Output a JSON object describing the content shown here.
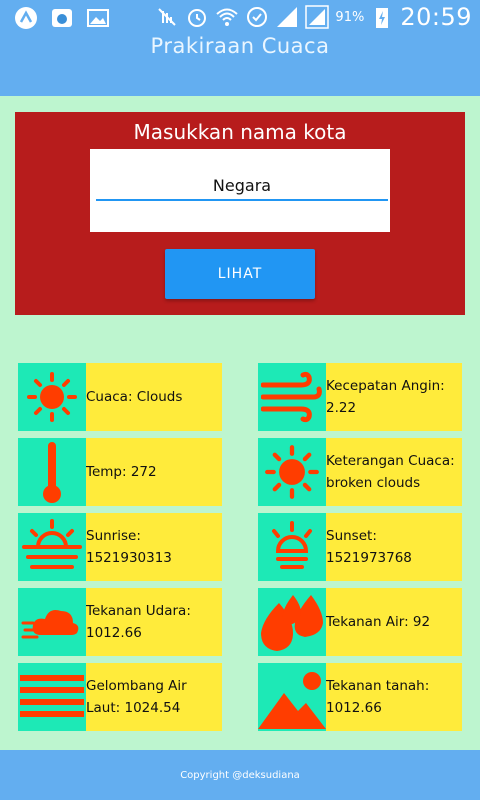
{
  "status_bar": {
    "battery": "91%",
    "time": "20:59"
  },
  "app": {
    "title": "Prakiraan Cuaca"
  },
  "form": {
    "label": "Masukkan nama kota",
    "city_value": "Negara",
    "button_label": "LIHAT"
  },
  "tiles": {
    "weather": "Cuaca: Clouds",
    "wind": "Kecepatan Angin: 2.22",
    "temp": "Temp: 272",
    "description": "Keterangan Cuaca: broken clouds",
    "sunrise": "Sunrise: 1521930313",
    "sunset": "Sunset: 1521973768",
    "pressure": "Tekanan Udara: 1012.66",
    "humidity": "Tekanan Air: 92",
    "sea_level": "Gelombang Air Laut: 1024.54",
    "ground_level": "Tekanan tanah: 1012.66"
  },
  "footer": {
    "copyright": "Copyright @deksudiana"
  },
  "colors": {
    "appbar": "#63aef0",
    "background": "#bdf5cf",
    "card": "#b71c1c",
    "button": "#2196f3",
    "icon_bg": "#1de9b6",
    "tile_bg": "#ffeb3b",
    "icon_fg": "#ff3d00"
  }
}
